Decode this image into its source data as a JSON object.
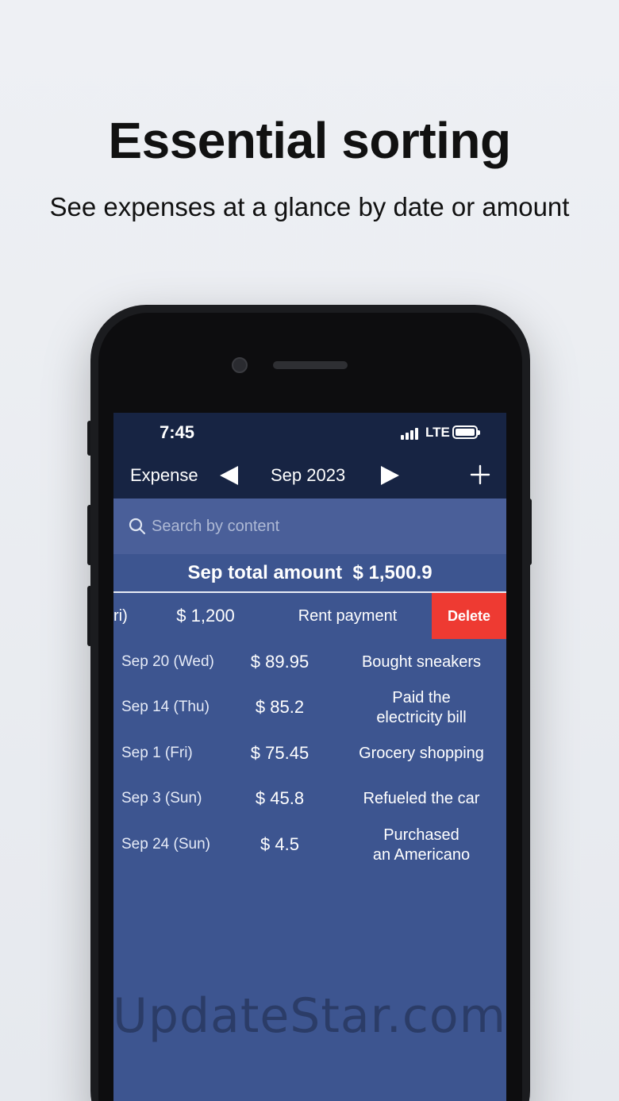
{
  "promo": {
    "headline": "Essential sorting",
    "subline": "See expenses at a glance by date or amount"
  },
  "status_bar": {
    "time": "7:45",
    "network": "LTE"
  },
  "navbar": {
    "title": "Expense",
    "month": "Sep 2023",
    "prev_icon": "triangle-left-icon",
    "next_icon": "triangle-right-icon",
    "add_icon": "plus-icon"
  },
  "search": {
    "placeholder": "Search by content",
    "icon": "search-icon"
  },
  "summary": {
    "label": "Sep total amount",
    "amount": "$ 1,500.9"
  },
  "swiped_row": {
    "date": "ri)",
    "amount": "$ 1,200",
    "description": "Rent payment",
    "delete_label": "Delete"
  },
  "rows": [
    {
      "date": "Sep 20 (Wed)",
      "amount": "$ 89.95",
      "desc1": "Bought sneakers",
      "desc2": ""
    },
    {
      "date": "Sep 14 (Thu)",
      "amount": "$ 85.2",
      "desc1": "Paid the",
      "desc2": "electricity bill"
    },
    {
      "date": "Sep 1 (Fri)",
      "amount": "$ 75.45",
      "desc1": "Grocery shopping",
      "desc2": ""
    },
    {
      "date": "Sep 3 (Sun)",
      "amount": "$ 45.8",
      "desc1": "Refueled the car",
      "desc2": ""
    },
    {
      "date": "Sep 24 (Sun)",
      "amount": "$ 4.5",
      "desc1": "Purchased",
      "desc2": "an Americano"
    }
  ],
  "watermark": "UpdateStar.com",
  "colors": {
    "header_bg": "#172443",
    "screen_bg": "#3d5590",
    "delete_red": "#ee3a32"
  }
}
